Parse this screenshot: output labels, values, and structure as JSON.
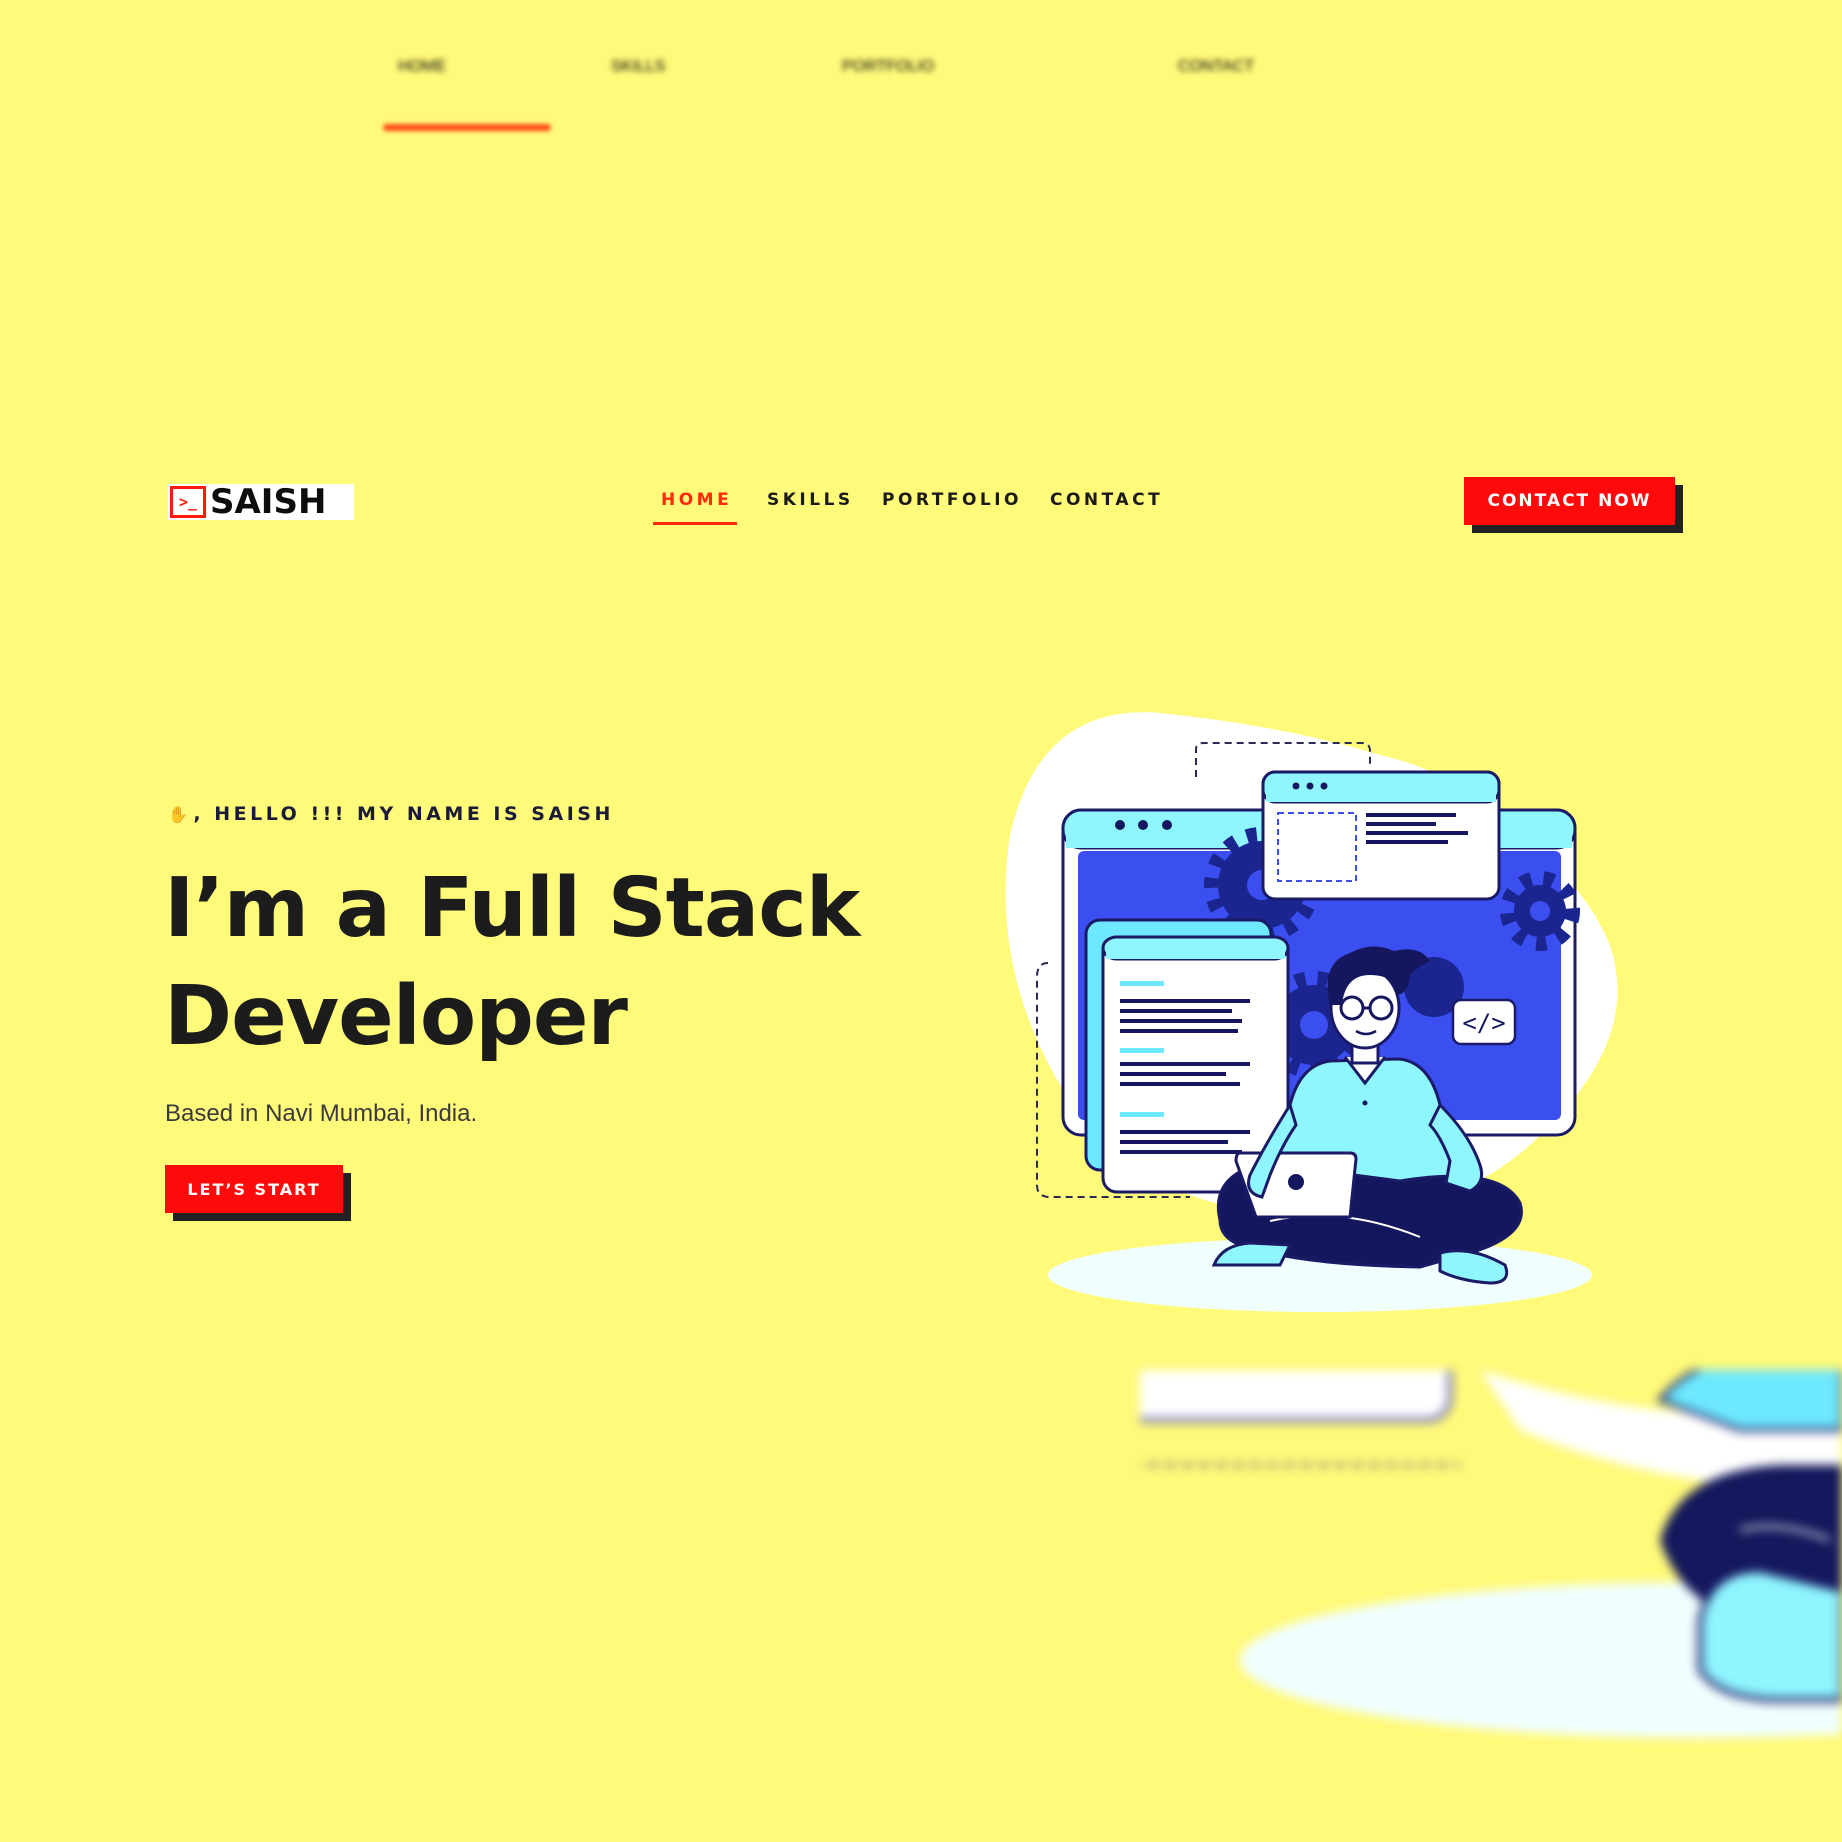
{
  "background_nav": {
    "items": [
      "HOME",
      "SKILLS",
      "PORTFOLIO",
      "CONTACT"
    ],
    "active_index": 0
  },
  "header": {
    "logo_text": "SAISH",
    "logo_mark": ">_",
    "nav": [
      "HOME",
      "SKILLS",
      "PORTFOLIO",
      "CONTACT"
    ],
    "active_index": 0,
    "cta_label": "CONTACT NOW"
  },
  "hero": {
    "greeting": ", HELLO !!! MY NAME IS SAISH",
    "headline_line1": "I’m a Full Stack",
    "headline_line2": "Developer",
    "subtitle": "Based in Navi Mumbai, India.",
    "start_label": "LET’S START"
  },
  "illustration": {
    "code_badge": "</>",
    "icons": [
      "waving-hand-icon",
      "terminal-icon",
      "gear-icon",
      "laptop-icon",
      "code-icon"
    ]
  },
  "colors": {
    "background": "#fffa7a",
    "accent": "#ff0a0a",
    "nav_active": "#ff2a0a",
    "text_dark": "#1c1c1c",
    "illus_blue": "#3b4ff0",
    "illus_cyan": "#8ff5ff",
    "illus_navy": "#15175e"
  }
}
